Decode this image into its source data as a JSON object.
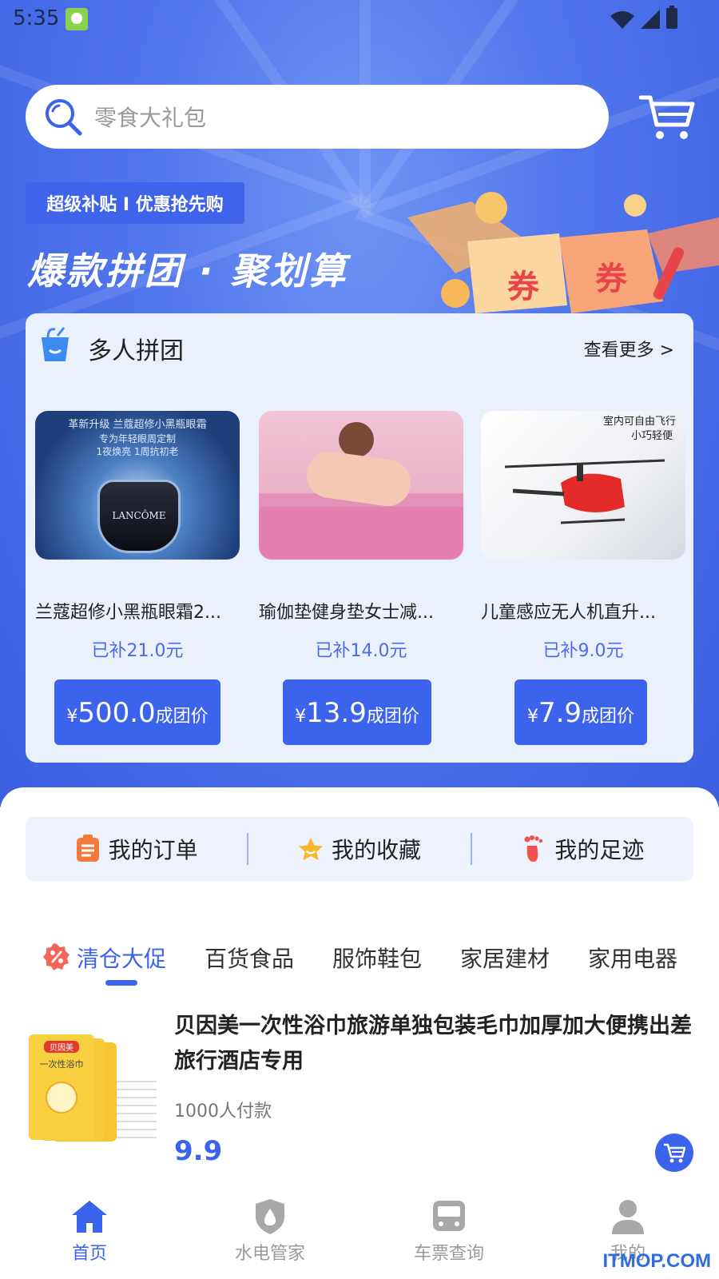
{
  "status_bar": {
    "time": "5:35"
  },
  "search": {
    "placeholder": "零食大礼包"
  },
  "hero": {
    "badge": "超级补贴 I 优惠抢先购",
    "title": "爆款拼团 · 聚划算",
    "coupon_text": "券"
  },
  "group_section": {
    "title": "多人拼团",
    "more": "查看更多 >",
    "products": [
      {
        "image_text_top": "革新升级 兰蔻超修小黑瓶眼霜",
        "image_text_sub": "专为年轻眼周定制",
        "image_text_sub2": "1夜焕亮 1周抗初老",
        "image_brand": "LANCÔME",
        "name": "兰蔻超修小黑瓶眼霜2...",
        "subsidy": "已补21.0元",
        "yen": "¥",
        "price": "500.0",
        "price_label": "成团价"
      },
      {
        "name": "瑜伽垫健身垫女士减...",
        "subsidy": "已补14.0元",
        "yen": "¥",
        "price": "13.9",
        "price_label": "成团价"
      },
      {
        "image_text_top": "室内可自由飞行",
        "image_text_sub": "小巧轻便",
        "name": "儿童感应无人机直升...",
        "subsidy": "已补9.0元",
        "yen": "¥",
        "price": "7.9",
        "price_label": "成团价"
      }
    ]
  },
  "quick_links": {
    "orders": "我的订单",
    "favorites": "我的收藏",
    "history": "我的足迹"
  },
  "categories": [
    "清仓大促",
    "百货食品",
    "服饰鞋包",
    "家居建材",
    "家用电器"
  ],
  "active_category_index": 0,
  "list": [
    {
      "title": "贝因美一次性浴巾旅游单独包装毛巾加厚加大便携出差旅行酒店专用",
      "package_brand": "贝因美",
      "package_text": "一次性浴巾",
      "sold": "1000人付款",
      "price": "9.9"
    }
  ],
  "bottom_nav": {
    "home": "首页",
    "utility": "水电管家",
    "tickets": "车票查询",
    "mine": "我的"
  },
  "watermark": "ITMOP.COM",
  "colors": {
    "accent": "#3c63ec",
    "hero_bg": "#4f74ec",
    "card_bg": "#eaf0fc",
    "nav_inactive": "#9a9a9a"
  },
  "icons": {
    "search": "search-icon",
    "cart": "cart-icon",
    "basket": "basket-icon",
    "orders": "clipboard-icon",
    "favorites": "star-icon",
    "history": "footprint-icon",
    "promo": "percent-icon",
    "home": "home-icon",
    "utility": "shield-drop-icon",
    "tickets": "bus-icon",
    "mine": "user-icon"
  }
}
